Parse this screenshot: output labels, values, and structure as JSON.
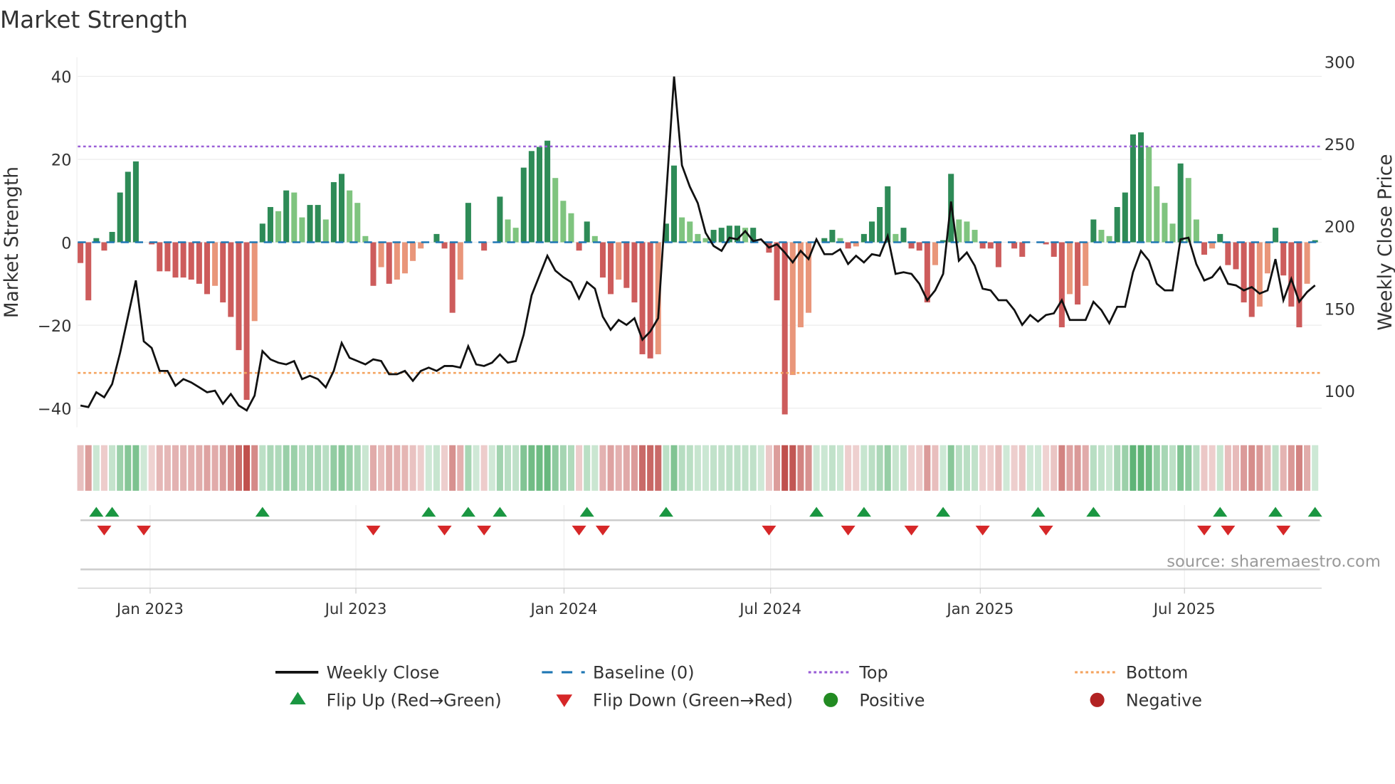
{
  "chart_data": {
    "type": "bar",
    "title": "Market Strength",
    "ylabel": "Market Strength",
    "y2label": "Weekly Close Price",
    "ylim": [
      -45,
      45
    ],
    "y2lim": [
      83,
      303
    ],
    "yticks": [
      40,
      20,
      0,
      -20,
      -40
    ],
    "ytick_labels": [
      "40",
      "20",
      "0",
      "−20",
      "−40"
    ],
    "y2ticks": [
      300,
      250,
      200,
      150,
      100
    ],
    "y2tick_labels": [
      "300",
      "250",
      "200",
      "150",
      "100"
    ],
    "x_unit": "week index",
    "xticks": [
      8.8,
      34.8,
      61.1,
      87.2,
      113.7,
      139.5
    ],
    "xtick_labels": [
      "Jan 2023",
      "Jul 2023",
      "Jan 2024",
      "Jul 2024",
      "Jan 2025",
      "Jul 2025"
    ],
    "top_level": 23.1,
    "bottom_level": -31.5,
    "baseline": 0,
    "strength": [
      -5,
      -14,
      1,
      -2,
      2.5,
      12,
      17,
      19.5,
      0,
      -0.5,
      -7,
      -7,
      -8.5,
      -8.5,
      -9,
      -10,
      -12.5,
      -10.5,
      -14.5,
      -18,
      -26,
      -38,
      -19,
      4.5,
      8.5,
      7.5,
      12.5,
      12,
      6,
      9,
      9,
      5.5,
      14.5,
      16.5,
      12.5,
      9.5,
      1.5,
      -10.5,
      -6,
      -10,
      -9,
      -7.5,
      -4.5,
      -1.5,
      0,
      2,
      -1.5,
      -17,
      -9,
      9.5,
      0,
      -2,
      0,
      11,
      5.5,
      3.5,
      18,
      22,
      23,
      24.5,
      15.5,
      10,
      7,
      -2,
      5,
      1.5,
      -8.5,
      -12.5,
      -9,
      -11,
      -14.5,
      -27,
      -28,
      -27,
      4.5,
      18.5,
      6,
      5,
      2,
      1,
      3,
      3.5,
      4,
      4,
      3.5,
      3.5,
      0,
      -2.5,
      -14,
      -41.5,
      -32,
      -20.5,
      -17,
      0,
      1,
      3,
      1,
      -1.5,
      -1,
      2,
      5,
      8.5,
      13.5,
      2,
      3.5,
      -1.5,
      -2,
      -14.5,
      -5.5,
      0.5,
      16.5,
      5.5,
      5,
      3,
      -1.5,
      -1.5,
      -6,
      0,
      -1.5,
      -3.5,
      0,
      0,
      -0.5,
      -3.5,
      -20.5,
      -12.5,
      -15,
      -10.5,
      5.5,
      3,
      1.5,
      8.5,
      12,
      26,
      26.5,
      23,
      13.5,
      9.5,
      4.5,
      19,
      15.5,
      5.5,
      -3,
      -1.5,
      2,
      -5.5,
      -6.5,
      -14.5,
      -18,
      -15.5,
      -7.5,
      3.5,
      -8,
      -15.5,
      -20.5,
      -10,
      0.5
    ],
    "weekly_close": [
      91,
      90,
      99,
      96,
      104,
      123,
      145,
      167,
      130,
      126,
      112,
      112,
      103,
      107,
      105,
      102,
      99,
      100,
      92,
      98,
      91,
      88,
      97,
      124,
      119,
      117,
      116,
      118,
      107,
      109,
      107,
      102,
      112,
      129,
      120,
      118,
      116,
      119,
      118,
      110,
      110,
      112,
      106,
      112,
      114,
      112,
      115,
      115,
      114,
      127,
      116,
      115,
      117,
      122,
      117,
      118,
      134,
      158,
      170,
      182,
      173,
      169,
      166,
      156,
      166,
      162,
      145,
      137,
      143,
      140,
      144,
      131,
      136,
      144,
      218,
      291,
      237,
      224,
      214,
      196,
      188,
      185,
      193,
      192,
      197,
      191,
      192,
      187,
      189,
      184,
      178,
      185,
      180,
      192,
      183,
      183,
      186,
      177,
      182,
      178,
      183,
      182,
      194,
      171,
      172,
      171,
      165,
      155,
      161,
      171,
      215,
      179,
      184,
      176,
      162,
      161,
      155,
      155,
      149,
      140,
      146,
      142,
      146,
      147,
      155,
      143,
      143,
      143,
      154,
      149,
      141,
      151,
      151,
      172,
      185,
      179,
      165,
      161,
      161,
      192,
      193,
      177,
      167,
      169,
      175,
      165,
      164,
      161,
      163,
      159,
      161,
      180,
      155,
      168,
      154,
      160,
      164
    ],
    "flip_up": [
      2,
      4,
      23,
      44,
      49,
      53,
      64,
      74,
      93,
      99,
      109,
      121,
      128,
      144,
      151,
      156
    ],
    "flip_down": [
      3,
      8,
      37,
      46,
      51,
      63,
      66,
      87,
      97,
      105,
      114,
      122,
      142,
      145,
      152
    ],
    "legend": [
      {
        "label": "Weekly Close",
        "kind": "line",
        "color": "#111111"
      },
      {
        "label": "Baseline (0)",
        "kind": "dash",
        "color": "#1f77b4"
      },
      {
        "label": "Top",
        "kind": "dot",
        "color": "#9a5fd6"
      },
      {
        "label": "Bottom",
        "kind": "dot",
        "color": "#f4a460"
      },
      {
        "label": "Flip Up (Red→Green)",
        "kind": "up",
        "color": "#1a9641"
      },
      {
        "label": "Flip Down (Green→Red)",
        "kind": "down",
        "color": "#d62728"
      },
      {
        "label": "Positive",
        "kind": "circle",
        "color": "#228b22"
      },
      {
        "label": "Negative",
        "kind": "circle",
        "color": "#b22222"
      }
    ],
    "legend_position": "bottom",
    "colors": {
      "pos_up": "#2e8b57",
      "pos_down": "#7fc47f",
      "neg_down": "#cd5c5c",
      "neg_up": "#e9967a",
      "grid": "#ececec"
    }
  },
  "source": "source: sharemaestro.com"
}
